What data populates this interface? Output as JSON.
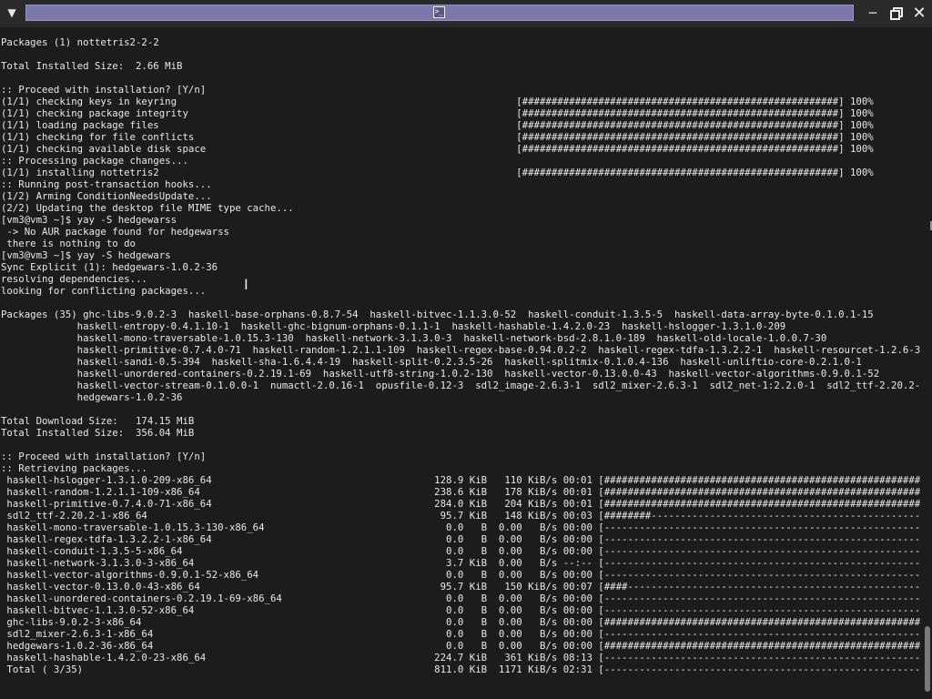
{
  "window": {
    "title": "",
    "menu_icon": "chevron-down-icon",
    "terminal_icon": "terminal-icon",
    "minimize_icon": "minimize-icon",
    "maximize_icon": "maximize-icon",
    "close_icon": "close-icon",
    "accent": "#7b78ab"
  },
  "terminal": {
    "background": "#1c1c1c",
    "foreground": "#e8e8e8",
    "lines": [
      "Packages (1) nottetris2-2-2",
      "",
      "Total Installed Size:  2.66 MiB",
      "",
      ":: Proceed with installation? [Y/n]",
      "(1/1) checking keys in keyring                                                          [######################################################] 100%",
      "(1/1) checking package integrity                                                        [######################################################] 100%",
      "(1/1) loading package files                                                             [######################################################] 100%",
      "(1/1) checking for file conflicts                                                       [######################################################] 100%",
      "(1/1) checking available disk space                                                     [######################################################] 100%",
      ":: Processing package changes...",
      "(1/1) installing nottetris2                                                             [######################################################] 100%",
      ":: Running post-transaction hooks...",
      "(1/2) Arming ConditionNeedsUpdate...",
      "(2/2) Updating the desktop file MIME type cache...",
      "[vm3@vm3 ~]$ yay -S hedgewarss",
      " -> No AUR package found for hedgewarss",
      " there is nothing to do",
      "[vm3@vm3 ~]$ yay -S hedgewars",
      "Sync Explicit (1): hedgewars-1.0.2-36",
      "resolving dependencies...",
      "looking for conflicting packages...",
      "",
      "Packages (35) ghc-libs-9.0.2-3  haskell-base-orphans-0.8.7-54  haskell-bitvec-1.1.3.0-52  haskell-conduit-1.3.5-5  haskell-data-array-byte-0.1.0.1-15",
      "             haskell-entropy-0.4.1.10-1  haskell-ghc-bignum-orphans-0.1.1-1  haskell-hashable-1.4.2.0-23  haskell-hslogger-1.3.1.0-209",
      "             haskell-mono-traversable-1.0.15.3-130  haskell-network-3.1.3.0-3  haskell-network-bsd-2.8.1.0-189  haskell-old-locale-1.0.0.7-30",
      "             haskell-primitive-0.7.4.0-71  haskell-random-1.2.1.1-109  haskell-regex-base-0.94.0.2-2  haskell-regex-tdfa-1.3.2.2-1  haskell-resourcet-1.2.6-31",
      "             haskell-sandi-0.5-394  haskell-sha-1.6.4.4-19  haskell-split-0.2.3.5-26  haskell-splitmix-0.1.0.4-136  haskell-unliftio-core-0.2.1.0-1",
      "             haskell-unordered-containers-0.2.19.1-69  haskell-utf8-string-1.0.2-130  haskell-vector-0.13.0.0-43  haskell-vector-algorithms-0.9.0.1-52",
      "             haskell-vector-stream-0.1.0.0-1  numactl-2.0.16-1  opusfile-0.12-3  sdl2_image-2.6.3-1  sdl2_mixer-2.6.3-1  sdl2_net-1:2.2.0-1  sdl2_ttf-2.20.2-1",
      "             hedgewars-1.0.2-36",
      "",
      "Total Download Size:   174.15 MiB",
      "Total Installed Size:  356.04 MiB",
      "",
      ":: Proceed with installation? [Y/n]",
      ":: Retrieving packages...",
      " haskell-hslogger-1.3.1.0-209-x86_64                                      128.9 KiB   110 KiB/s 00:01 [######################################################] 100%",
      " haskell-random-1.2.1.1-109-x86_64                                        238.6 KiB   178 KiB/s 00:01 [######################################################] 100%",
      " haskell-primitive-0.7.4.0-71-x86_64                                      284.0 KiB   204 KiB/s 00:01 [######################################################] 100%",
      " sdl2_ttf-2.20.2-1-x86_64                                                  95.7 KiB   148 KiB/s 00:03 [########----------------------------------------------]  15%",
      " haskell-mono-traversable-1.0.15.3-130-x86_64                               0.0   B  0.00   B/s 00:00 [------------------------------------------------------]   0%",
      " haskell-regex-tdfa-1.3.2.2-1-x86_64                                        0.0   B  0.00   B/s 00:00 [------------------------------------------------------]   0%",
      " haskell-conduit-1.3.5-5-x86_64                                             0.0   B  0.00   B/s 00:00 [------------------------------------------------------]   0%",
      " haskell-network-3.1.3.0-3-x86_64                                           3.7 KiB  0.00   B/s --:-- [------------------------------------------------------]   1%",
      " haskell-vector-algorithms-0.9.0.1-52-x86_64                                0.0   B  0.00   B/s 00:00 [------------------------------------------------------]   0%",
      " haskell-vector-0.13.0.0-43-x86_64                                         95.7 KiB   150 KiB/s 00:07 [####--------------------------------------------------]   7%",
      " haskell-unordered-containers-0.2.19.1-69-x86_64                            0.0   B  0.00   B/s 00:00 [------------------------------------------------------]   0%",
      " haskell-bitvec-1.1.3.0-52-x86_64                                           0.0   B  0.00   B/s 00:00 [------------------------------------------------------]   0%",
      " ghc-libs-9.0.2-3-x86_64                                                    0.0   B  0.00   B/s 00:00 [######################################################] 100%",
      " sdl2_mixer-2.6.3-1-x86_64                                                  0.0   B  0.00   B/s 00:00 [------------------------------------------------------]   0%",
      " hedgewars-1.0.2-36-x86_64                                                  0.0   B  0.00   B/s 00:00 [######################################################] 100%",
      " haskell-hashable-1.4.2.0-23-x86_64                                       224.7 KiB   361 KiB/s 08:13 [------------------------------------------------------]   0%",
      " Total ( 3/35)                                                            811.0 KiB  1171 KiB/s 02:31 [------------------------------------------------------]   0%"
    ]
  }
}
